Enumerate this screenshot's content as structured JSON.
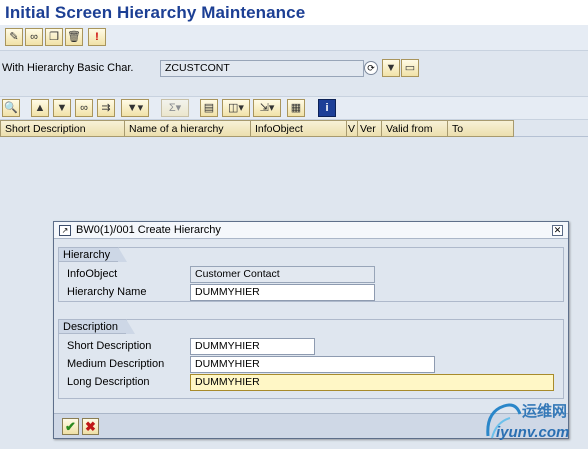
{
  "page": {
    "title": "Initial Screen Hierarchy Maintenance"
  },
  "app_toolbar": {
    "buttons": [
      {
        "icon": "pencil-icon",
        "glyph": "✎"
      },
      {
        "icon": "display-glasses-icon",
        "glyph": "∞"
      },
      {
        "icon": "copy-icon",
        "glyph": "❐"
      },
      {
        "icon": "trash-icon",
        "glyph": "🗑"
      },
      {
        "icon": "info-exclamation-icon",
        "glyph": "!"
      }
    ]
  },
  "basic_char": {
    "label": "With Hierarchy Basic Char.",
    "value": "ZCUSTCONT"
  },
  "table": {
    "columns": [
      "Short Description",
      "Name of a hierarchy",
      "InfoObject",
      "V",
      "Ver",
      "Valid from",
      "To"
    ]
  },
  "dialog": {
    "title": "BW0(1)/001 Create Hierarchy",
    "hierarchy_group": {
      "title": "Hierarchy",
      "infoobject_label": "InfoObject",
      "infoobject_value": "Customer Contact",
      "name_label": "Hierarchy Name",
      "name_value": "DUMMYHIER"
    },
    "description_group": {
      "title": "Description",
      "short_label": "Short Description",
      "short_value": "DUMMYHIER",
      "medium_label": "Medium Description",
      "medium_value": "DUMMYHIER",
      "long_label": "Long Description",
      "long_value": "DUMMYHIER"
    },
    "confirm_glyph": "✔",
    "cancel_glyph": "✖"
  },
  "watermark": {
    "text_cn": "运维网",
    "text_url": "iyunv.com"
  },
  "colors": {
    "title_blue": "#1c3f94",
    "background": "#dfe6ef",
    "focus_field": "#fff7c6",
    "confirm_green": "#2b8a1f",
    "cancel_red": "#c01818"
  }
}
